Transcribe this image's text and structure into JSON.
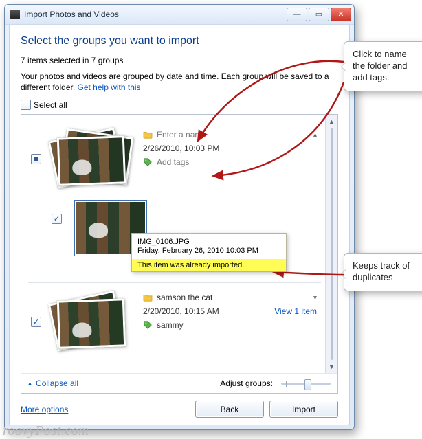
{
  "window": {
    "title": "Import Photos and Videos"
  },
  "heading": "Select the groups you want to import",
  "summary": "7 items selected in 7 groups",
  "desc_line": "Your photos and videos are grouped by date and time. Each group will be saved to a different folder. ",
  "help_link": "Get help with this",
  "select_all": "Select all",
  "groups": [
    {
      "name_placeholder": "Enter a name",
      "date": "2/26/2010, 10:03 PM",
      "tags_placeholder": "Add tags",
      "checked": "filled",
      "tooltip": {
        "file": "IMG_0106.JPG",
        "date": "Friday, February 26, 2010 10:03 PM",
        "dup": "This item was already imported."
      }
    },
    {
      "name": "samson the cat",
      "date": "2/20/2010, 10:15 AM",
      "tag": "sammy",
      "view_link": "View 1 item",
      "checked": "checked"
    }
  ],
  "collapse": "Collapse all",
  "adjust_label": "Adjust groups:",
  "more_options": "More options",
  "buttons": {
    "back": "Back",
    "import": "Import"
  },
  "callouts": {
    "c1": "Click to name the folder and add tags.",
    "c2": "Keeps track of duplicates"
  },
  "watermark": "roovyPost.com"
}
